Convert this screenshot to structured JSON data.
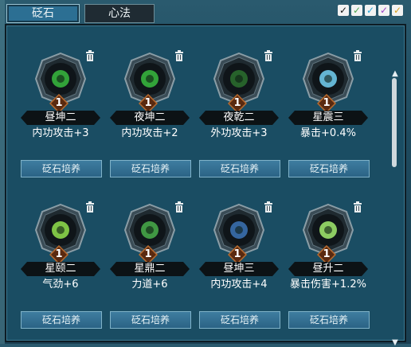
{
  "tabs": {
    "active": "砭石",
    "inactive": "心法"
  },
  "colors": {
    "accent": "#2c6f93",
    "check_colors": [
      "#111111",
      "#4fa54f",
      "#2aa6d6",
      "#9b42c4",
      "#d6a01d"
    ]
  },
  "checks": [
    "✓",
    "✓",
    "✓",
    "✓",
    "✓"
  ],
  "cards": [
    {
      "level": "1",
      "name": "昼坤二",
      "stat": "内功攻击+3",
      "train": "砭石培养",
      "gem_color": "#36b23d",
      "gem_icon": "green-sprout-gem"
    },
    {
      "level": "1",
      "name": "夜坤二",
      "stat": "内功攻击+2",
      "train": "砭石培养",
      "gem_color": "#36b23d",
      "gem_icon": "green-sprout-gem"
    },
    {
      "level": "1",
      "name": "夜乾二",
      "stat": "外功攻击+3",
      "train": "砭石培养",
      "gem_color": "#2a6a2e",
      "gem_icon": "dark-green-gem"
    },
    {
      "level": "1",
      "name": "星震三",
      "stat": "暴击+0.4%",
      "train": "砭石培养",
      "gem_color": "#6ec7e8",
      "gem_icon": "blue-star-gem"
    },
    {
      "level": "1",
      "name": "星颐二",
      "stat": "气劲+6",
      "train": "砭石培养",
      "gem_color": "#8bd64a",
      "gem_icon": "green-swirl-gem"
    },
    {
      "level": "1",
      "name": "星鼎二",
      "stat": "力道+6",
      "train": "砭石培养",
      "gem_color": "#46a548",
      "gem_icon": "green-crescent-gem"
    },
    {
      "level": "1",
      "name": "昼坤三",
      "stat": "内功攻击+4",
      "train": "砭石培养",
      "gem_color": "#3a6fae",
      "gem_icon": "blue-orb-gem"
    },
    {
      "level": "1",
      "name": "昼升二",
      "stat": "暴击伤害+1.2%",
      "train": "砭石培养",
      "gem_color": "#9be06a",
      "gem_icon": "green-star-gem"
    }
  ]
}
